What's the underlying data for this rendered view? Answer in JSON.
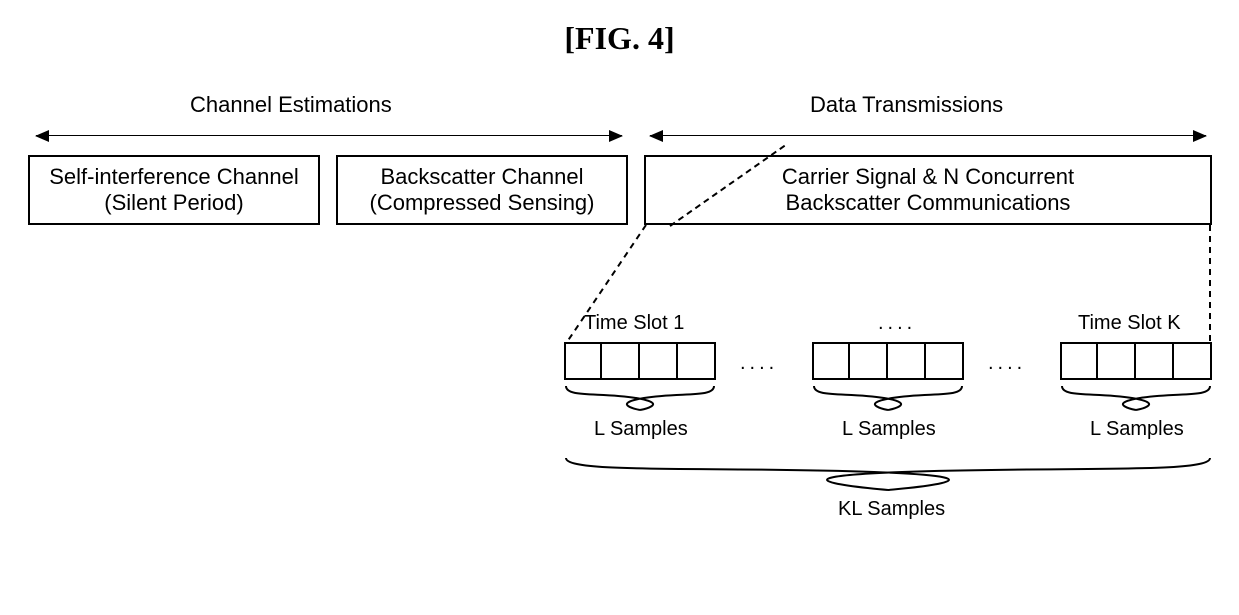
{
  "title": "[FIG. 4]",
  "phases": {
    "channel": "Channel Estimations",
    "data": "Data Transmissions"
  },
  "boxes": {
    "self_if_line1": "Self-interference Channel",
    "self_if_line2": "(Silent Period)",
    "backscatter_line1": "Backscatter Channel",
    "backscatter_line2": "(Compressed Sensing)",
    "carrier_line1": "Carrier Signal & N Concurrent",
    "carrier_line2": "Backscatter Communications"
  },
  "slots": {
    "slot1": "Time Slot 1",
    "slotk": "Time Slot K",
    "dots_upper": "....",
    "dots_lower": "...."
  },
  "samples": {
    "l": "L Samples",
    "kl": "KL Samples"
  }
}
